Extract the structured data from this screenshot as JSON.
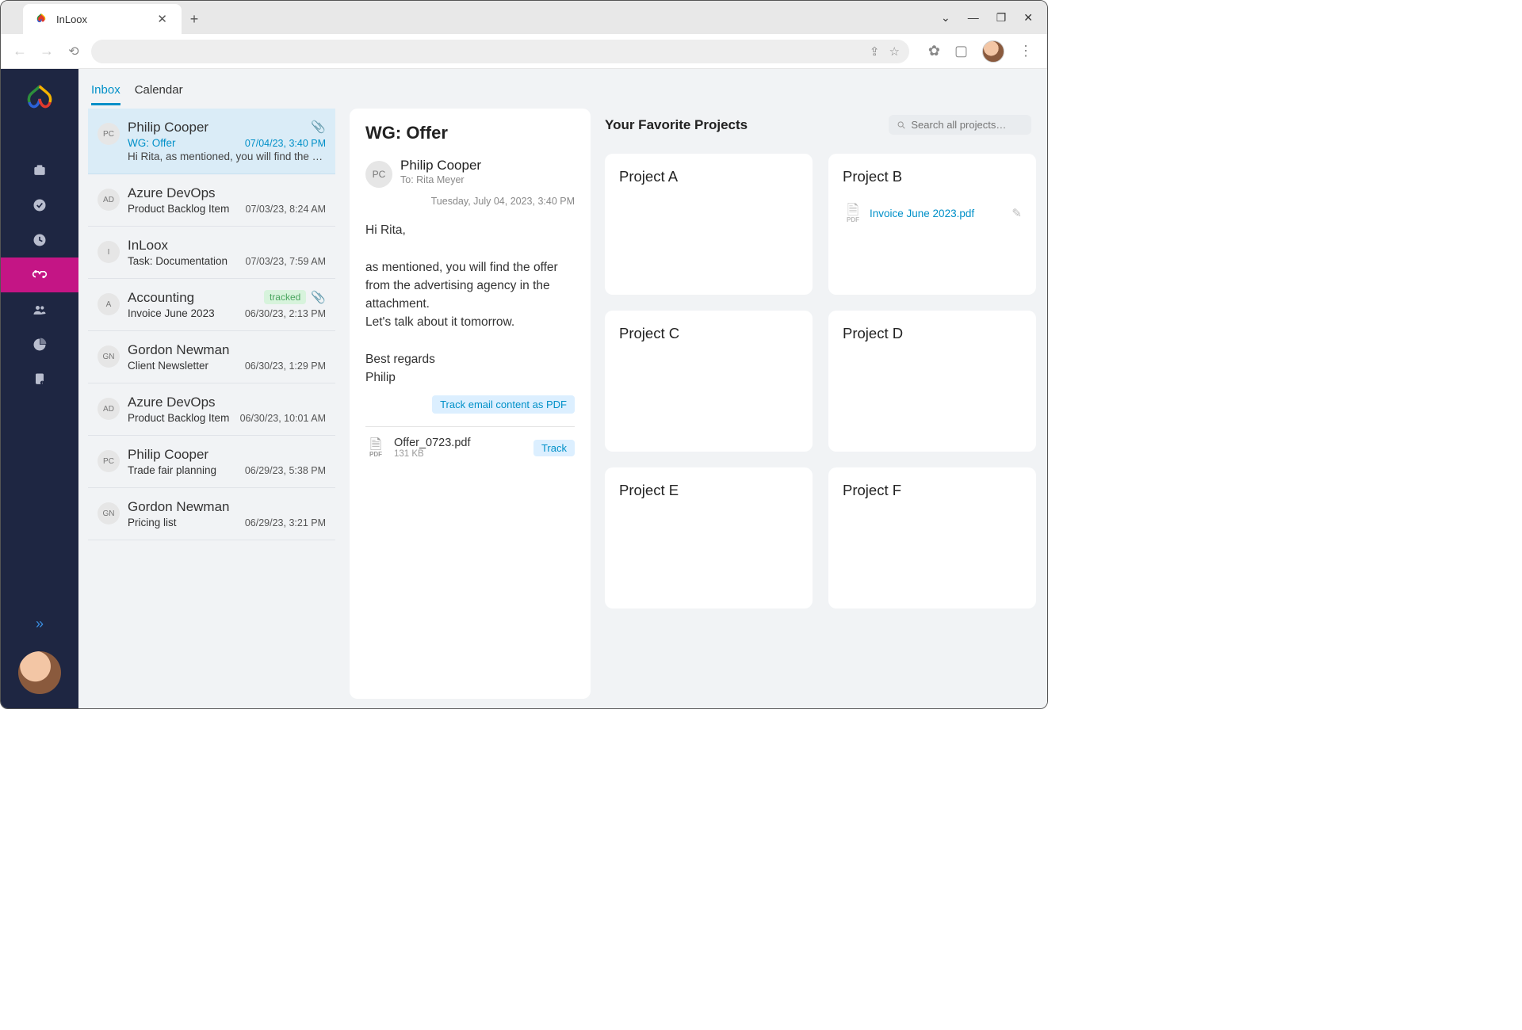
{
  "window": {
    "tab_title": "InLoox"
  },
  "tabs": {
    "inbox": "Inbox",
    "calendar": "Calendar"
  },
  "inbox": [
    {
      "initials": "PC",
      "sender": "Philip Cooper",
      "subject": "WG: Offer",
      "date": "07/04/23, 3:40 PM",
      "preview": "Hi Rita, as mentioned, you will find the of…",
      "has_attachment": true,
      "selected": true
    },
    {
      "initials": "AD",
      "sender": "Azure DevOps",
      "subject": "Product Backlog Item",
      "date": "07/03/23, 8:24 AM"
    },
    {
      "initials": "I",
      "sender": "InLoox",
      "subject": "Task: Documentation",
      "date": "07/03/23, 7:59 AM"
    },
    {
      "initials": "A",
      "sender": "Accounting",
      "subject": "Invoice June 2023",
      "date": "06/30/23, 2:13 PM",
      "tracked": true,
      "has_attachment": true
    },
    {
      "initials": "GN",
      "sender": "Gordon Newman",
      "subject": "Client Newsletter",
      "date": "06/30/23, 1:29 PM"
    },
    {
      "initials": "AD",
      "sender": "Azure DevOps",
      "subject": "Product Backlog Item",
      "date": "06/30/23, 10:01 AM"
    },
    {
      "initials": "PC",
      "sender": "Philip Cooper",
      "subject": "Trade fair planning",
      "date": "06/29/23, 5:38 PM"
    },
    {
      "initials": "GN",
      "sender": "Gordon Newman",
      "subject": "Pricing list",
      "date": "06/29/23, 3:21 PM"
    }
  ],
  "detail": {
    "title": "WG: Offer",
    "from_initials": "PC",
    "from": "Philip Cooper",
    "to": "To: Rita Meyer",
    "date": "Tuesday, July 04, 2023, 3:40 PM",
    "body": "Hi Rita,\n\nas mentioned, you will find the offer from the advertising agency in the attachment.\nLet's talk about it tomorrow.\n\nBest regards\nPhilip",
    "track_email_label": "Track email content as PDF",
    "attachment_name": "Offer_0723.pdf",
    "attachment_size": "131 KB",
    "track_label": "Track",
    "pdf_label": "PDF"
  },
  "projects": {
    "title": "Your Favorite Projects",
    "search_placeholder": "Search all projects…",
    "cards": [
      {
        "name": "Project A"
      },
      {
        "name": "Project B",
        "file": "Invoice June 2023.pdf"
      },
      {
        "name": "Project C"
      },
      {
        "name": "Project D"
      },
      {
        "name": "Project E"
      },
      {
        "name": "Project F"
      }
    ]
  },
  "tracked_label": "tracked"
}
